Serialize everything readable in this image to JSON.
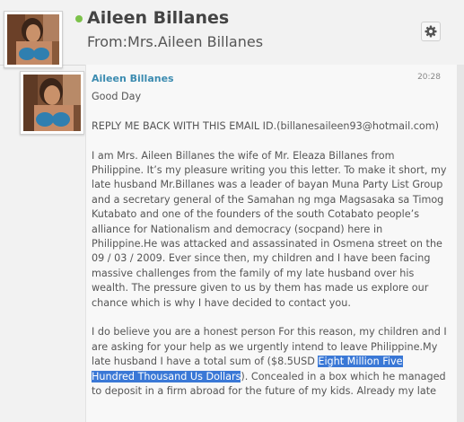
{
  "header": {
    "name": "Aileen Billanes",
    "from": "From:Mrs.Aileen Billanes",
    "status_color": "#7cc24a",
    "settings_icon": "gear-icon"
  },
  "message": {
    "sender": "Aileen Billanes",
    "time": "20:28",
    "greeting": "Good Day",
    "line2": "REPLY ME BACK WITH THIS EMAIL ID.(billanesaileen93@hotmail.com)",
    "para1": "I am Mrs. Aileen Billanes the wife of Mr. Eleaza Billanes from Philippine. It’s my pleasure writing you this letter. To make it short, my late husband Mr.Billanes was a leader of bayan Muna Party List Group and a secretary general of the Samahan ng mga Magsasaka sa Timog Kutabato and one of the founders of the south Cotabato people’s alliance for Nationalism and democracy (socpand) here in Philippine.He was attacked and assassinated in Osmena street on the 09 / 03 / 2009. Ever since then, my children and I have been facing massive challenges from the family of my late husband over his wealth. The pressure given to us by them has made us explore our chance which is why I have decided to contact you.",
    "para2_pre": "I do believe you are a honest person For this reason, my children and I are asking for your help as we urgently intend to leave Philippine.My late husband I have a total sum of ($8.5USD ",
    "para2_highlight": "Eight Million Five Hundred Thousand Us Dollars",
    "para2_post": "). Concealed in a box which he managed to deposit in a firm abroad for the future of my kids. Already my late",
    "highlight_color": "#3a78d6"
  }
}
